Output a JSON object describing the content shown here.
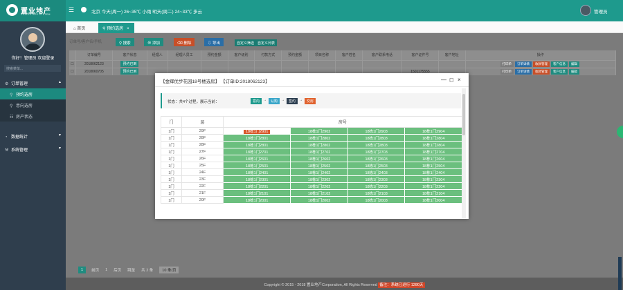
{
  "header": {
    "logo_text": "置业地产",
    "logo_sub": "REALESTATE SYSTEM",
    "menu_icon": "menu-icon",
    "weather": "北京  今天(周一) 26~35℃ 小雨  明天(周二) 24~33℃ 多云",
    "user": "管理员"
  },
  "sidebar": {
    "greeting": "你好！管理员  欢迎登录",
    "search_placeholder": "搜索菜单...",
    "items": [
      {
        "label": "订单管理",
        "icon": "gear-icon",
        "expanded": true
      },
      {
        "label": "预约选房",
        "icon": "search-icon",
        "sub": true,
        "active": true
      },
      {
        "label": "意向选房",
        "icon": "search-icon",
        "sub": true
      },
      {
        "label": "房产状态",
        "icon": "sitemap-icon",
        "sub": true
      },
      {
        "label": "数据统计",
        "icon": "chart-icon"
      },
      {
        "label": "系统管理",
        "icon": "wrench-icon"
      }
    ]
  },
  "tabs": {
    "home": "首页",
    "active": "预约选房",
    "close": "×"
  },
  "toolbar": {
    "search_placeholder": "订单号/客户名/手机",
    "search": "搜索",
    "add": "添加",
    "delete": "删除",
    "export": "导出",
    "custom_filter": "自定义筛选",
    "custom_columns": "自定义列表"
  },
  "grid": {
    "columns": [
      "",
      "订单编号",
      "客户状态",
      "经理人",
      "经理人员工",
      "预约金额",
      "客户级别",
      "付款方式",
      "预约金额",
      "项目名称",
      "客户姓名",
      "客户联系电话",
      "客户证件号",
      "客户地址",
      "操作"
    ],
    "rows": [
      {
        "order": "2018062123",
        "status": "预约已到",
        "status_color": "#1f8c80",
        "tag": "",
        "mobile": ""
      },
      {
        "order": "2018060705",
        "status": "预约已到",
        "status_color": "#1f8c80",
        "tag": "",
        "mobile": "1501175555"
      }
    ],
    "ops": [
      "打印单",
      "订单详情",
      "收款管理",
      "客户信息",
      "编辑"
    ]
  },
  "pager": {
    "current": "1",
    "prev": "前页",
    "page": "1",
    "next": "后页",
    "goto": "跳至",
    "total": "共 2 条",
    "per_page": "10 条/页"
  },
  "footer": {
    "text": "Copyright © 2015 - 2018 置业地产Corporation, All Rights Reserved",
    "badge": "备注：系统已运行 1280天"
  },
  "modal": {
    "title": "【金辉优步花园18号楼选房】  【订单ID:2018062123】",
    "minimize": "—",
    "maximize": "◻",
    "close": "×",
    "status_text": "状态：共4个过程，展示当前：",
    "stages": [
      {
        "label": "意向",
        "color": "#1e9a8d"
      },
      {
        "label": "认购",
        "color": "#3aa6c9"
      },
      {
        "label": "签约",
        "color": "#2c3e50"
      },
      {
        "label": "交房",
        "color": "#e0622e"
      }
    ],
    "table": {
      "headers": [
        "门",
        "层",
        "房号"
      ],
      "rows": [
        {
          "door": "1门",
          "floor": "29F",
          "rooms": [
            "18栋1门2901",
            "18栋1门2902",
            "18栋1门2903",
            "18栋1门2904"
          ],
          "selected": 0
        },
        {
          "door": "1门",
          "floor": "28F",
          "rooms": [
            "18栋1门2801",
            "18栋1门2802",
            "18栋1门2803",
            "18栋1门2804"
          ]
        },
        {
          "door": "1门",
          "floor": "28F",
          "rooms": [
            "18栋1门2801",
            "18栋1门2802",
            "18栋1门2803",
            "18栋1门2804"
          ]
        },
        {
          "door": "1门",
          "floor": "27F",
          "rooms": [
            "18栋1门2701",
            "18栋1门2702",
            "18栋1门2703",
            "18栋1门2704"
          ]
        },
        {
          "door": "1门",
          "floor": "26F",
          "rooms": [
            "18栋1门2601",
            "18栋1门2602",
            "18栋1门2603",
            "18栋1门2604"
          ]
        },
        {
          "door": "1门",
          "floor": "25F",
          "rooms": [
            "18栋1门2501",
            "18栋1门2502",
            "18栋1门2503",
            "18栋1门2504"
          ]
        },
        {
          "door": "1门",
          "floor": "24F",
          "rooms": [
            "18栋1门2401",
            "18栋1门2402",
            "18栋1门2403",
            "18栋1门2404"
          ]
        },
        {
          "door": "1门",
          "floor": "23F",
          "rooms": [
            "18栋1门2301",
            "18栋1门2302",
            "18栋1门2303",
            "18栋1门2304"
          ]
        },
        {
          "door": "1门",
          "floor": "22F",
          "rooms": [
            "18栋1门2201",
            "18栋1门2202",
            "18栋1门2203",
            "18栋1门2204"
          ]
        },
        {
          "door": "1门",
          "floor": "21F",
          "rooms": [
            "18栋1门2101",
            "18栋1门2102",
            "18栋1门2103",
            "18栋1门2104"
          ]
        },
        {
          "door": "1门",
          "floor": "20F",
          "rooms": [
            "18栋1门2001",
            "18栋1门2002",
            "18栋1门2003",
            "18栋1门2004"
          ]
        }
      ]
    }
  }
}
